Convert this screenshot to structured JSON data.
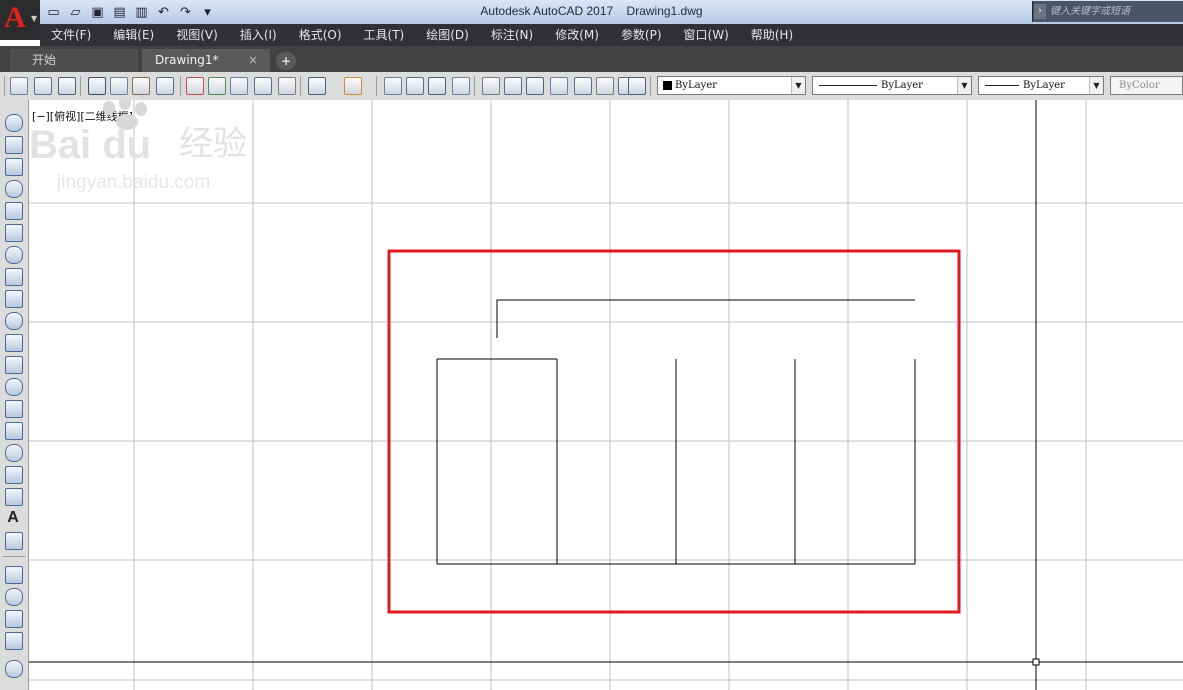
{
  "window": {
    "app_title": "Autodesk AutoCAD 2017",
    "doc_title": "Drawing1.dwg",
    "logo_letter": "A",
    "search_placeholder": "键入关键字或短语"
  },
  "quick_access": {
    "icons": [
      "new-icon",
      "open-icon",
      "save-icon",
      "save-as-icon",
      "plot-icon",
      "undo-icon",
      "redo-icon",
      "customize-icon"
    ]
  },
  "menu": {
    "items": [
      "文件(F)",
      "编辑(E)",
      "视图(V)",
      "插入(I)",
      "格式(O)",
      "工具(T)",
      "绘图(D)",
      "标注(N)",
      "修改(M)",
      "参数(P)",
      "窗口(W)",
      "帮助(H)"
    ]
  },
  "tabs": {
    "start": "开始",
    "drawing": "Drawing1*",
    "close": "×",
    "add": "+"
  },
  "properties": {
    "color": "ByLayer",
    "linetype": "ByLayer",
    "lineweight": "ByLayer",
    "plotstyle": "ByColor"
  },
  "viewport": {
    "label": "[−][俯视][二维线框]"
  },
  "colors": {
    "highlight_frame": "#e0191f",
    "geometry": "#000000",
    "grid": "#bfc2c8",
    "axis": "#000000",
    "app_red": "#e2231a"
  },
  "watermark": {
    "brand": "Bai du",
    "brand_cn": "经验",
    "url": "jingyan.baidu.com"
  }
}
